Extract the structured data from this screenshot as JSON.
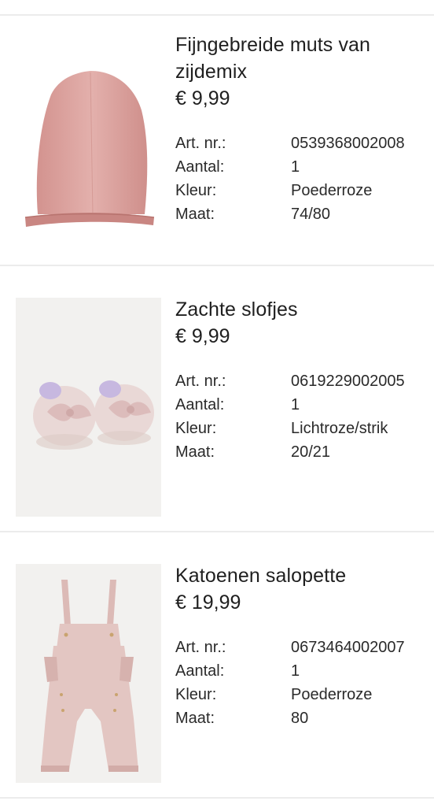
{
  "items": [
    {
      "title": "Fijngebreide muts van zijdemix",
      "price": "€ 9,99",
      "image_icon": "beanie-hat",
      "details": [
        {
          "label": "Art. nr.:",
          "value": "0539368002008"
        },
        {
          "label": "Aantal:",
          "value": "1"
        },
        {
          "label": "Kleur:",
          "value": "Poederroze"
        },
        {
          "label": "Maat:",
          "value": "74/80"
        }
      ]
    },
    {
      "title": "Zachte slofjes",
      "price": "€ 9,99",
      "image_icon": "baby-slippers",
      "details": [
        {
          "label": "Art. nr.:",
          "value": "0619229002005"
        },
        {
          "label": "Aantal:",
          "value": "1"
        },
        {
          "label": "Kleur:",
          "value": "Lichtroze/strik"
        },
        {
          "label": "Maat:",
          "value": "20/21"
        }
      ]
    },
    {
      "title": "Katoenen salopette",
      "price": "€ 19,99",
      "image_icon": "baby-overalls",
      "details": [
        {
          "label": "Art. nr.:",
          "value": "0673464002007"
        },
        {
          "label": "Aantal:",
          "value": "1"
        },
        {
          "label": "Kleur:",
          "value": "Poederroze"
        },
        {
          "label": "Maat:",
          "value": "80"
        }
      ]
    }
  ],
  "colors": {
    "divider": "#ececec",
    "text": "#1f1f1f",
    "image_bg": "#f2f1ef",
    "pink": "#d9a6a3"
  }
}
